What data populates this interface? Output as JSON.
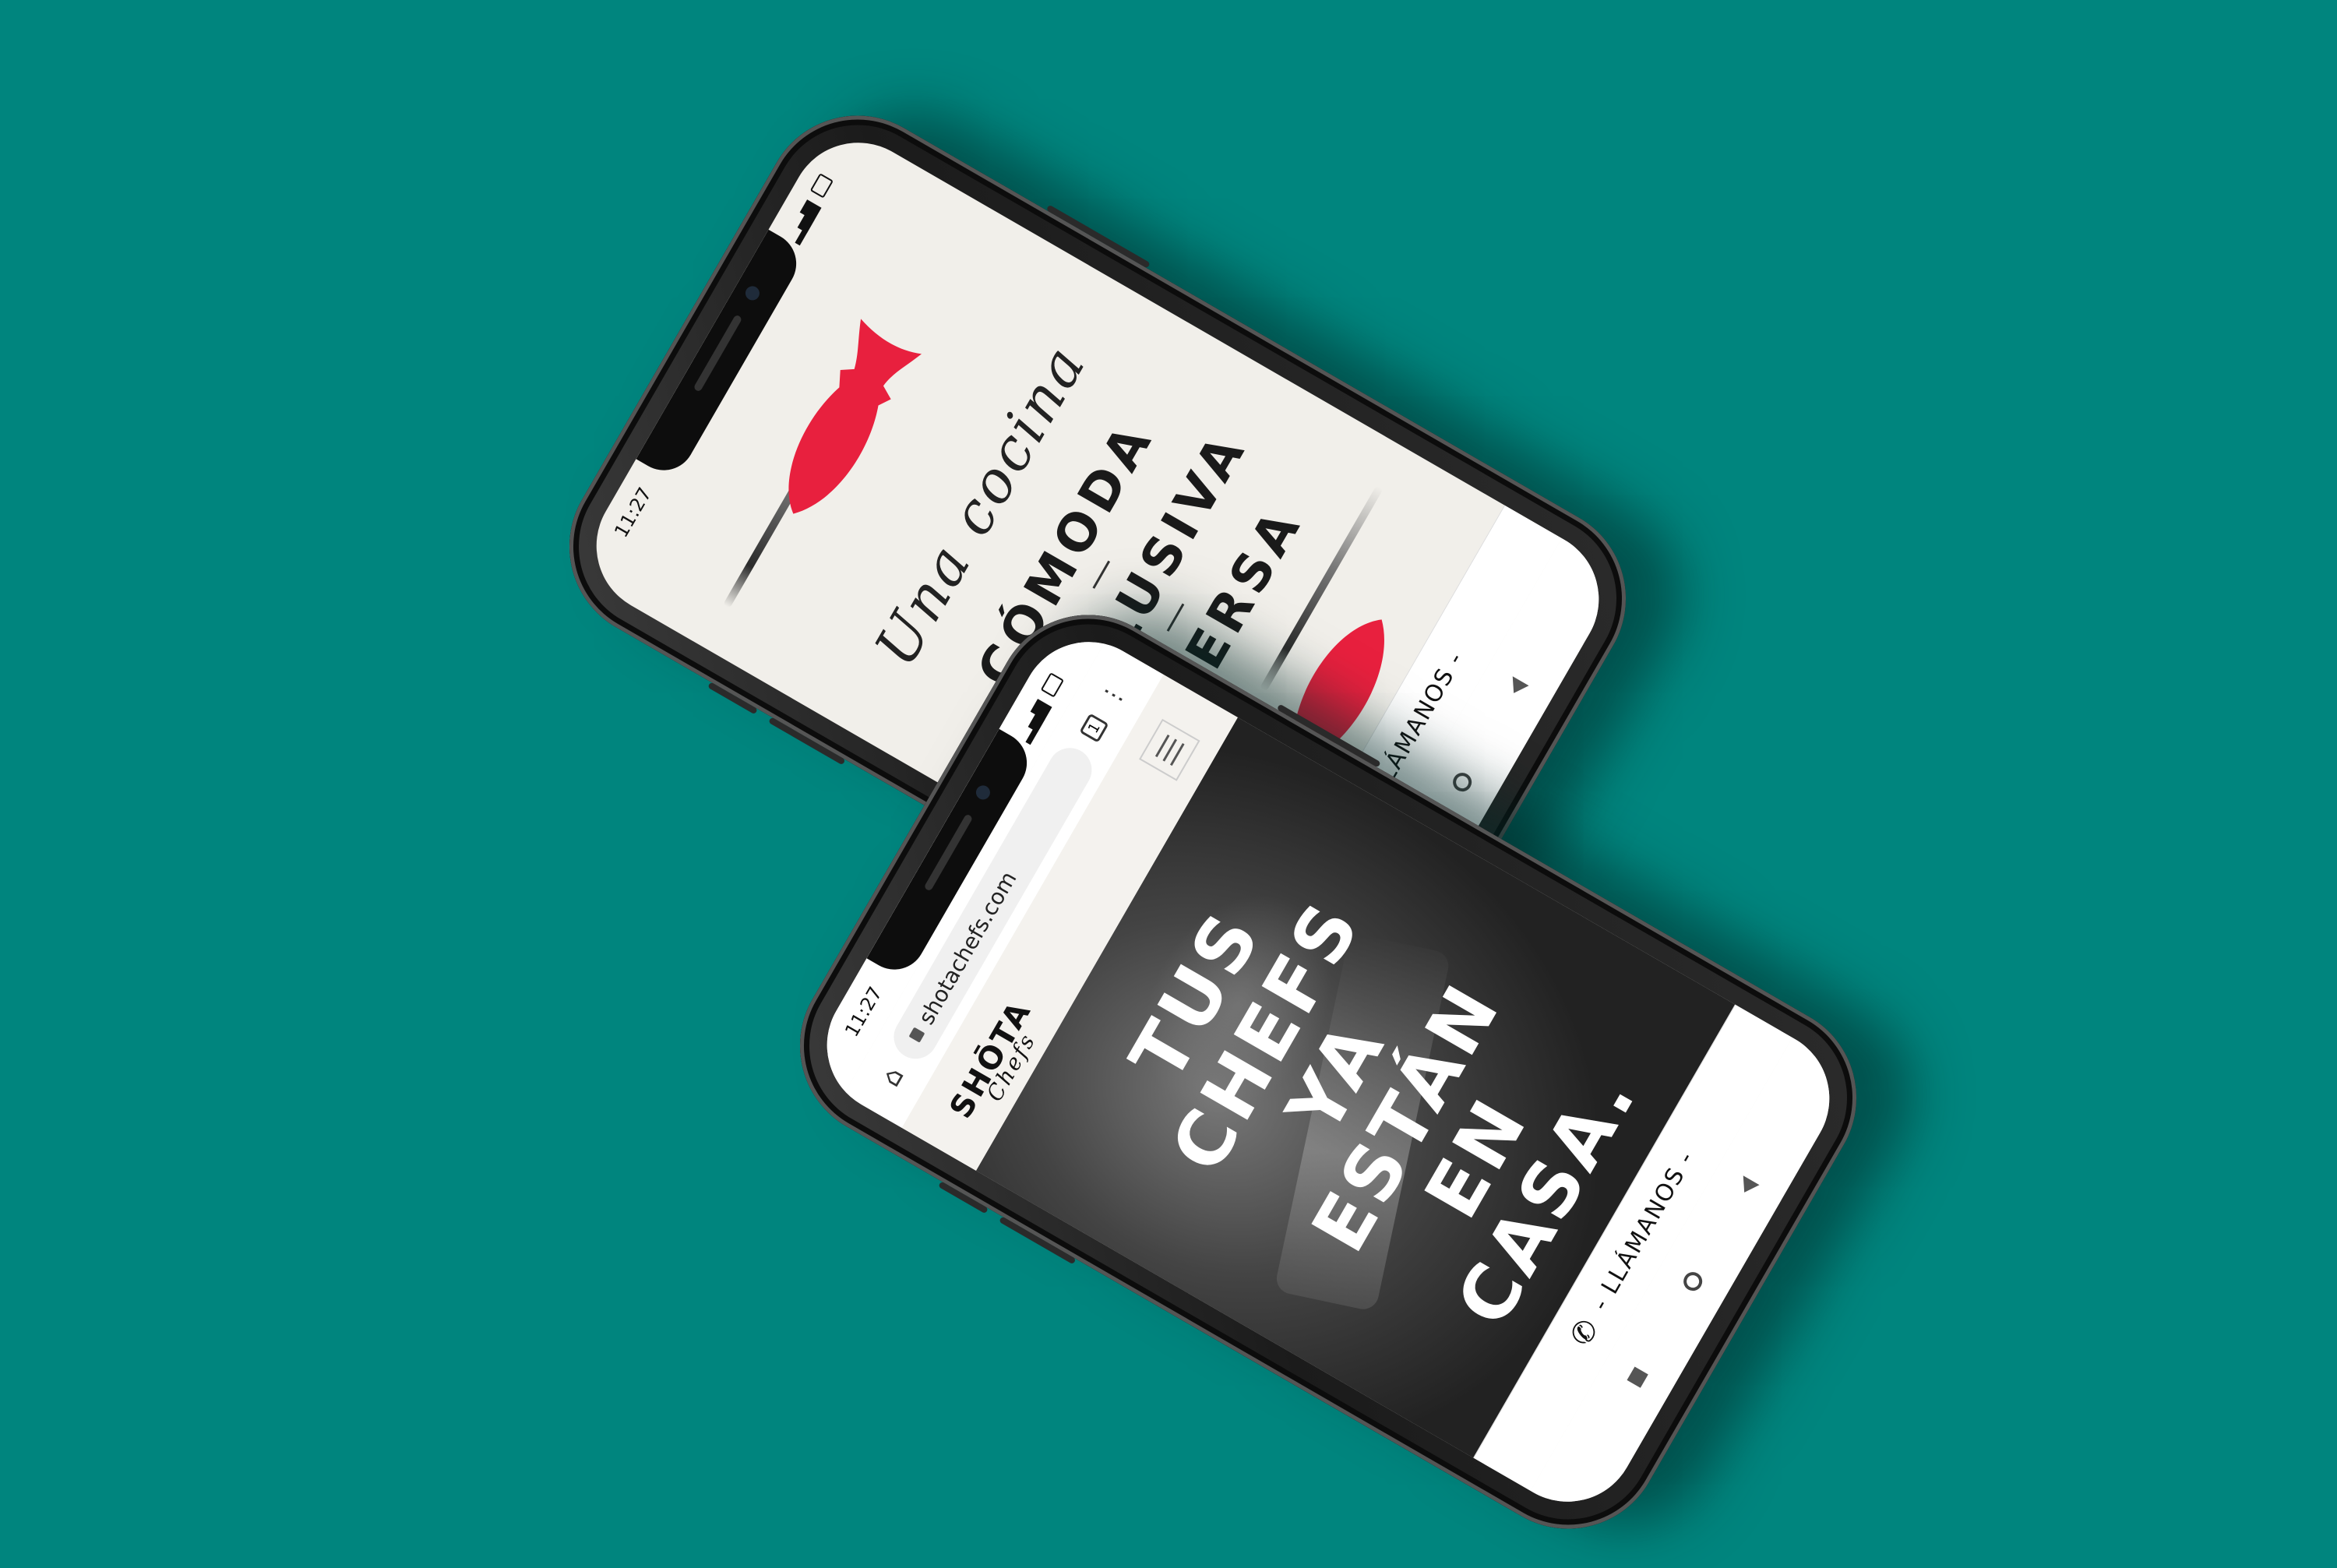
{
  "colors": {
    "background": "#00857e",
    "fish": "#e8203e",
    "screen": "#f1efea"
  },
  "phone1": {
    "status_time": "11:27",
    "script_line": "Una cocina",
    "words": [
      "CÓMODA",
      "EXCLUSIVA",
      "DIVERSA"
    ],
    "call_label": "- LLÁMANOS -",
    "icons": [
      "fish-icon",
      "phone-icon"
    ]
  },
  "phone2": {
    "status_time": "11:27",
    "url": "shotachefs.com",
    "tab_count": "1",
    "logo_main": "SHŌTA",
    "logo_sub": "Chefs",
    "hero_lines": [
      "TUS",
      "CHEFS",
      "YA",
      "ESTÁN",
      "EN",
      "CASA."
    ],
    "call_label": "- LLÁMANOS -"
  }
}
